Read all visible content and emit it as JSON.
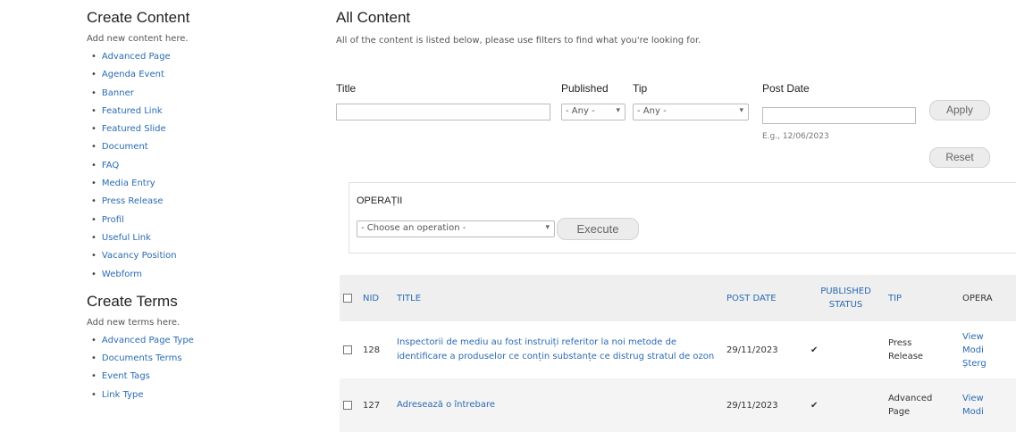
{
  "sidebar": {
    "create_content_title": "Create Content",
    "create_content_desc": "Add new content here.",
    "content_items": [
      "Advanced Page",
      "Agenda Event",
      "Banner",
      "Featured Link",
      "Featured Slide",
      "Document",
      "FAQ",
      "Media Entry",
      "Press Release",
      "Profil",
      "Useful Link",
      "Vacancy Position",
      "Webform"
    ],
    "create_terms_title": "Create Terms",
    "create_terms_desc": "Add new terms here.",
    "term_items": [
      "Advanced Page Type",
      "Documents Terms",
      "Event Tags",
      "Link Type"
    ]
  },
  "main": {
    "title": "All Content",
    "description": "All of the content is listed below, please use filters to find what you're looking for."
  },
  "filters": {
    "title_label": "Title",
    "title_value": "",
    "published_label": "Published",
    "published_value": "- Any -",
    "tip_label": "Tip",
    "tip_value": "- Any -",
    "post_date_label": "Post Date",
    "post_date_value": "",
    "post_date_hint": "E.g., 12/06/2023",
    "apply_label": "Apply",
    "reset_label": "Reset"
  },
  "operations": {
    "title": "OPERAȚII",
    "select_value": "- Choose an operation -",
    "execute_label": "Execute"
  },
  "table": {
    "headers": {
      "nid": "NID",
      "title": "TITLE",
      "post_date": "POST DATE",
      "published_status_1": "PUBLISHED",
      "published_status_2": "STATUS",
      "tip": "TIP",
      "operations": "OPERA"
    },
    "rows": [
      {
        "nid": "128",
        "title": "Inspectorii de mediu au fost instruiți referitor la noi metode de identificare a produselor ce conțin substanțe ce distrug stratul de ozon",
        "post_date": "29/11/2023",
        "published": "✔",
        "tip_1": "Press",
        "tip_2": "Release",
        "op_view": "View",
        "op_edit": "Modi",
        "op_delete": "Șterg"
      },
      {
        "nid": "127",
        "title": "Adresează o întrebare",
        "post_date": "29/11/2023",
        "published": "✔",
        "tip_1": "Advanced",
        "tip_2": "Page",
        "op_view": "View",
        "op_edit": "Modi"
      }
    ]
  }
}
